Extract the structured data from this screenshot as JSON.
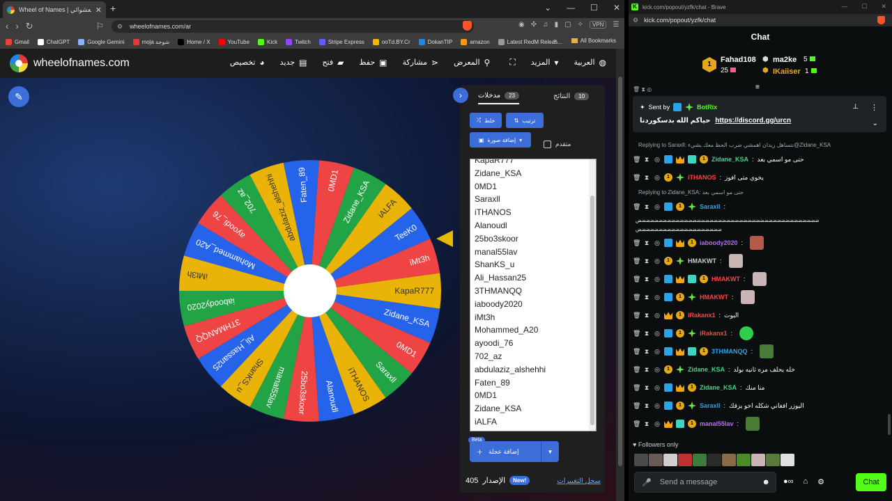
{
  "browser": {
    "tab_title": "Wheel of Names | عجلة الاسم العشوائي",
    "url": "wheelofnames.com/ar",
    "vpn_label": "VPN",
    "bookmarks": [
      {
        "label": "Gmail",
        "color": "#ea4335"
      },
      {
        "label": "ChatGPT",
        "color": "#ffffff"
      },
      {
        "label": "Google Gemini",
        "color": "#8ab4f8"
      },
      {
        "label": "moja شوجة",
        "color": "#e53935"
      },
      {
        "label": "Home / X",
        "color": "#000000"
      },
      {
        "label": "YouTube",
        "color": "#ff0000"
      },
      {
        "label": "Kick",
        "color": "#53fc18"
      },
      {
        "label": "Twitch",
        "color": "#9146ff"
      },
      {
        "label": "Stripe Express",
        "color": "#635bff"
      },
      {
        "label": "ooTd.BY.Cr",
        "color": "#f8b400"
      },
      {
        "label": "DokanTIP",
        "color": "#1e88e5"
      },
      {
        "label": "amazon",
        "color": "#ff9900"
      },
      {
        "label": "Latest RedM Releas...",
        "color": "#999999"
      }
    ],
    "all_bookmarks": "All Bookmarks"
  },
  "site": {
    "brand": "wheelofnames.com",
    "menu": [
      {
        "label": "العربية",
        "icon": "globe-icon"
      },
      {
        "label": "المزيد",
        "icon": "caret-down-icon"
      },
      {
        "label": "",
        "icon": "fullscreen-icon"
      },
      {
        "label": "المعرض",
        "icon": "search-icon"
      },
      {
        "label": "مشاركة",
        "icon": "share-icon"
      },
      {
        "label": "حفظ",
        "icon": "save-icon"
      },
      {
        "label": "فتح",
        "icon": "folder-icon"
      },
      {
        "label": "جديد",
        "icon": "file-icon"
      },
      {
        "label": "تخصيص",
        "icon": "palette-icon"
      }
    ]
  },
  "wheel": {
    "segment_colors": [
      "#eab308",
      "#2563eb",
      "#ef4444",
      "#22a345"
    ],
    "labels": [
      "KapaR777",
      "Zidane_KSA",
      "0MD1",
      "Saraxll",
      "iTHANOS",
      "Alanoudl",
      "25bo3skoor",
      "manal55lav",
      "ShanKS_u",
      "Ali_Hassan25",
      "3THMANQQ",
      "iaboody2020",
      "iMt3h",
      "Mohammed_A20",
      "ayoodi_76",
      "702_az",
      "abdulaziz_alshehhi",
      "Faten_89",
      "0MD1",
      "Zidane_KSA",
      "iALFA",
      "TeeK0",
      "iMt3h"
    ]
  },
  "panel": {
    "tab_entries": "مدخلات",
    "entries_count": "23",
    "tab_results": "النتائج",
    "results_count": "10",
    "shuffle": "خلط",
    "sort": "ترتيب",
    "add_image": "إضافة صورة",
    "advanced": "متقدم",
    "entries": [
      "KapaR777",
      "Zidane_KSA",
      "0MD1",
      "Saraxll",
      "iTHANOS",
      "Alanoudl",
      "25bo3skoor",
      "manal55lav",
      "ShanKS_u",
      "Ali_Hassan25",
      "3THMANQQ",
      "iaboody2020",
      "iMt3h",
      "Mohammed_A20",
      "ayoodi_76",
      "702_az",
      "abdulaziz_alshehhi",
      "Faten_89",
      "0MD1",
      "Zidane_KSA",
      "iALFA"
    ],
    "beta": "Beta",
    "add_wheel": "إضافة عجلة",
    "version_label": "الإصدار",
    "version_number": "405",
    "new_badge": "New!",
    "changelog": "سجل التغييرات"
  },
  "popout": {
    "title": "kick.com/popout/yzfk/chat - Brave",
    "url": "kick.com/popout/yzfk/chat",
    "heading": "Chat",
    "leaderboard": [
      {
        "name": "Fahad108",
        "count": "25",
        "rank": "1"
      },
      {
        "name": "ma2ke",
        "count": "5"
      },
      {
        "name": "IKaiiser",
        "count": "1"
      }
    ],
    "pinned": {
      "sent_by": "Sent by",
      "user": "BotRix",
      "text": "حياكم الله بدسكوردنا",
      "link": "https://discord.gg/urcn"
    },
    "messages": [
      {
        "type": "reply",
        "text": "Replying to Saraxll: نتساهل زيدان اهمشي ضرب الحظ معك بشيء@Zidane_KSA"
      },
      {
        "user": "Zidane_KSA",
        "color": "#3dd68c",
        "text": "حتى مو اسمي بعد"
      },
      {
        "user": "iTHANOS",
        "color": "#ff4141",
        "text": "يخوي متى افوز"
      },
      {
        "type": "reply",
        "text": "Replying to Zidane_KSA: حتى مو اسمي بعد"
      },
      {
        "user": "Saraxll",
        "color": "#2aa3e8",
        "text": ""
      },
      {
        "type": "plain",
        "text": "ضضضضضضضضضضضضضضضضضضضضضضضضضضضضضضضضضضضضضضضضضضض"
      },
      {
        "type": "plain",
        "text": "ضضضضضضضضضضضضضضضضضضضض"
      },
      {
        "user": "iaboody2020",
        "color": "#b56cf0",
        "text": ""
      },
      {
        "user": "HMAKWT",
        "color": "#cccccc",
        "text": ""
      },
      {
        "user": "HMAKWT",
        "color": "#ff4141",
        "text": ""
      },
      {
        "user": "HMAKWT",
        "color": "#ff4141",
        "text": ""
      },
      {
        "user": "iRakanx1",
        "color": "#ff4141",
        "text": "البوت"
      },
      {
        "user": "iRakanx1",
        "color": "#ff4141",
        "text": ""
      },
      {
        "user": "3THMANQQ",
        "color": "#2aa3e8",
        "text": ""
      },
      {
        "user": "Zidane_KSA",
        "color": "#3dd68c",
        "text": "خله يحلف مره ثانيه بولد"
      },
      {
        "user": "Zidane_KSA",
        "color": "#3dd68c",
        "text": "منا منك"
      },
      {
        "user": "Saraxll",
        "color": "#2aa3e8",
        "text": "اليوزر افغاني شكله اخو يزقك"
      },
      {
        "user": "manal55lav",
        "color": "#b56cf0",
        "text": ""
      }
    ],
    "followers_only": "Followers only",
    "placeholder": "Send a message",
    "chat_button": "Chat"
  }
}
